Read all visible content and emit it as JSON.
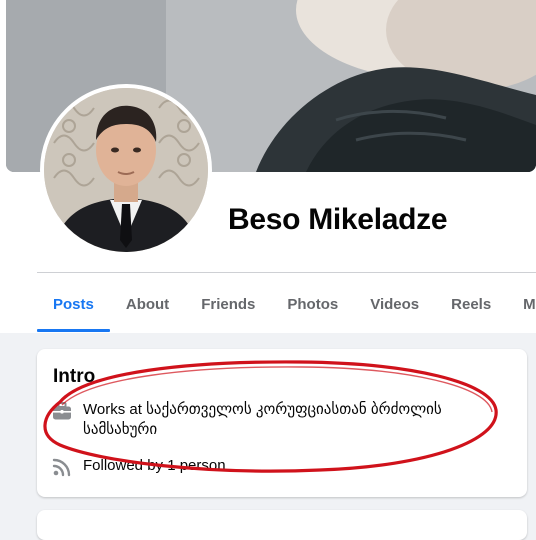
{
  "profile": {
    "name": "Beso Mikeladze"
  },
  "tabs": [
    {
      "label": "Posts",
      "active": true
    },
    {
      "label": "About",
      "active": false
    },
    {
      "label": "Friends",
      "active": false
    },
    {
      "label": "Photos",
      "active": false
    },
    {
      "label": "Videos",
      "active": false
    },
    {
      "label": "Reels",
      "active": false
    },
    {
      "label": "More",
      "active": false
    }
  ],
  "intro": {
    "title": "Intro",
    "work": "Works at საქართველოს კორუფციასთან ბრძოლის სამსახური",
    "followed_by": "Followed by 1 person",
    "work_icon": "briefcase-icon",
    "followed_icon": "rss-feed-icon"
  },
  "colors": {
    "accent": "#1877f2",
    "annotation": "#d0121b",
    "background": "#f0f2f5",
    "muted_text": "#65676b"
  }
}
